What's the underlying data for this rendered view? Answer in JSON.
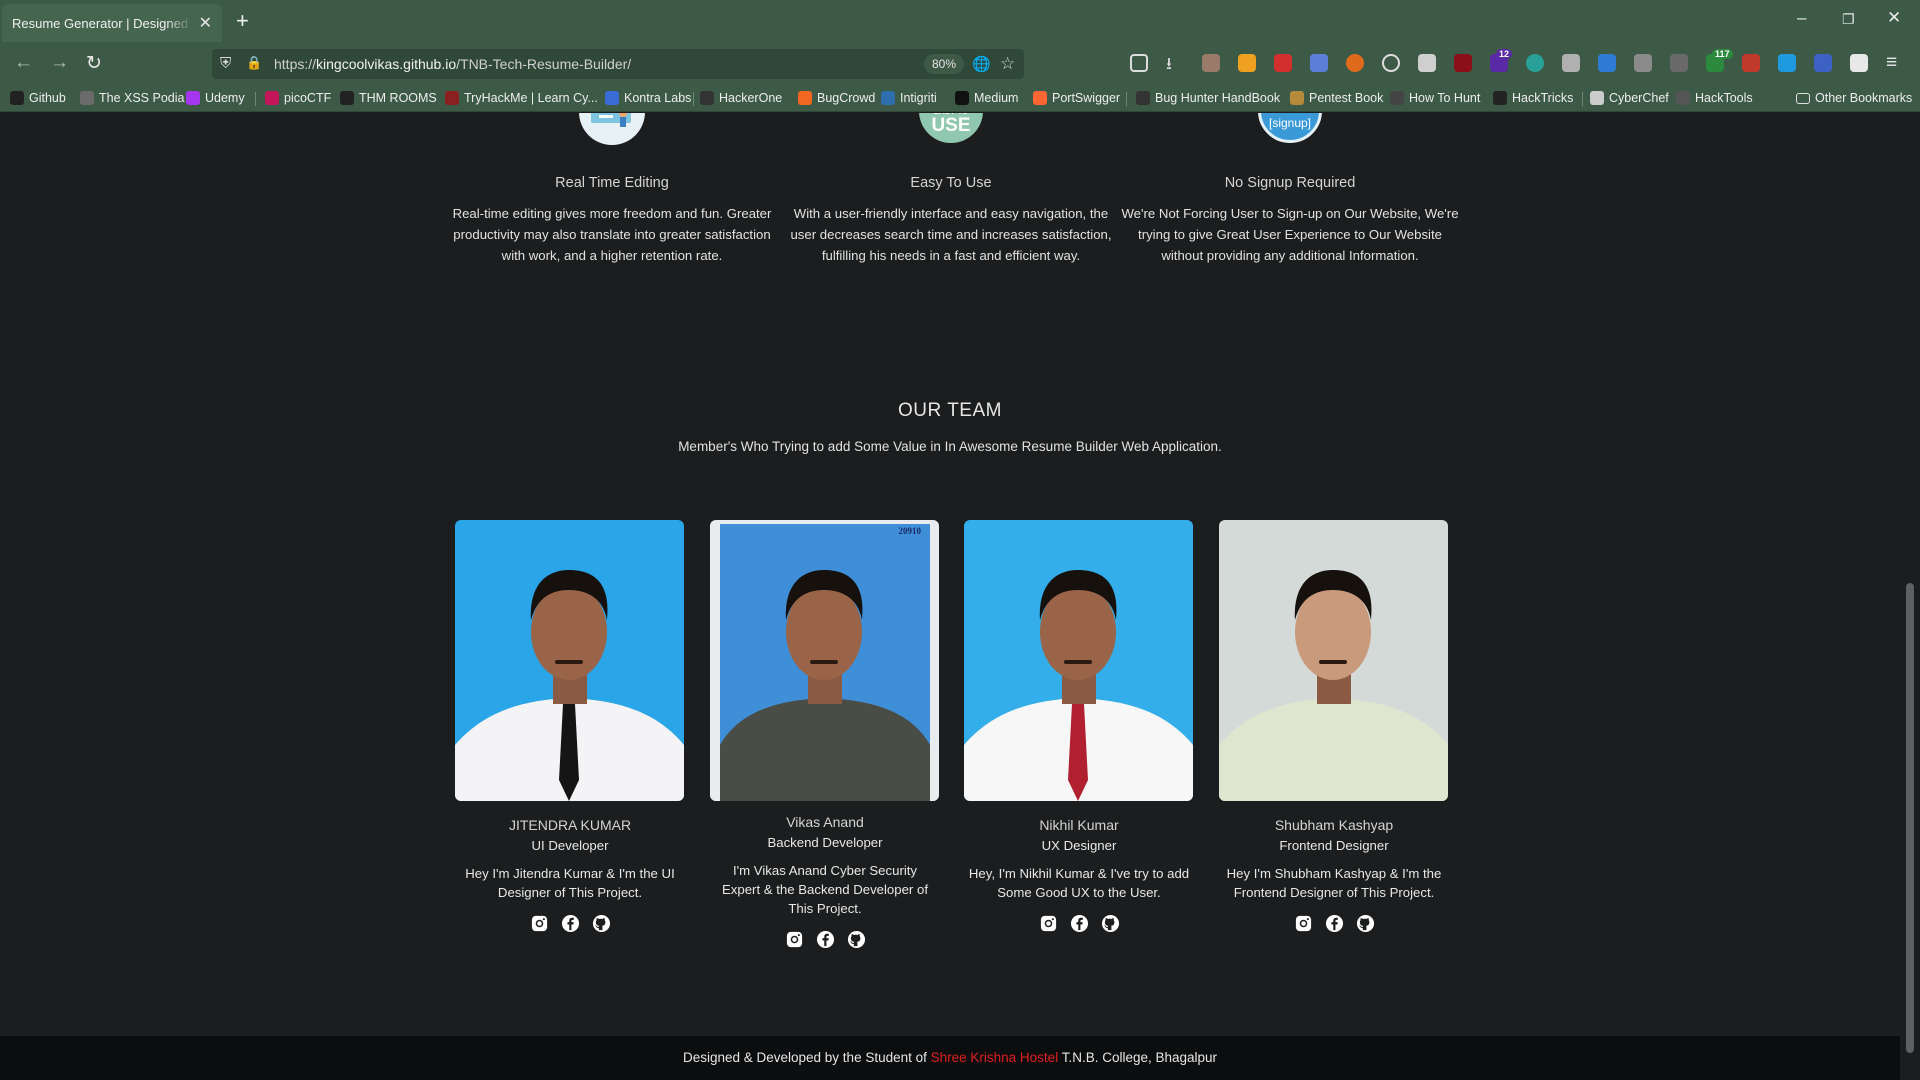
{
  "browser": {
    "tab_title": "Resume Generator | Designed by the Student",
    "url_prefix": "https://",
    "url_domain": "kingcoolvikas.github.io",
    "url_path": "/TNB-Tech-Resume-Builder/",
    "zoom": "80%",
    "ext_badges": {
      "ublock_count": "12",
      "tabs_count": "117"
    },
    "bookmarks": [
      {
        "label": "Github",
        "icon": "github-icon",
        "color": "#222222"
      },
      {
        "label": "The XSS Podia",
        "icon": "document-icon",
        "color": "#6b6b6b"
      },
      {
        "label": "Udemy",
        "icon": "udemy-icon",
        "color": "#a435f0"
      },
      {
        "label": "picoCTF",
        "icon": "pico-icon",
        "color": "#c2185b"
      },
      {
        "label": "THM ROOMS",
        "icon": "github-icon",
        "color": "#222222"
      },
      {
        "label": "TryHackMe | Learn Cy...",
        "icon": "thm-icon",
        "color": "#8a2020"
      },
      {
        "label": "Kontra Labs",
        "icon": "kontra-icon",
        "color": "#3a6bd6"
      },
      {
        "label": "HackerOne",
        "icon": "h1-icon",
        "color": "#333333"
      },
      {
        "label": "BugCrowd",
        "icon": "bugcrowd-icon",
        "color": "#f26822"
      },
      {
        "label": "Intigriti",
        "icon": "intigriti-icon",
        "color": "#2f6fb0"
      },
      {
        "label": "Medium",
        "icon": "medium-icon",
        "color": "#111111"
      },
      {
        "label": "PortSwigger",
        "icon": "portswigger-icon",
        "color": "#ff6633"
      },
      {
        "label": "Bug Hunter HandBook",
        "icon": "handbook-icon",
        "color": "#333333"
      },
      {
        "label": "Pentest Book",
        "icon": "book-icon",
        "color": "#b58a3a"
      },
      {
        "label": "How To Hunt",
        "icon": "hunter-icon",
        "color": "#444444"
      },
      {
        "label": "HackTricks",
        "icon": "hacktricks-icon",
        "color": "#222222"
      },
      {
        "label": "CyberChef",
        "icon": "chef-icon",
        "color": "#cccccc"
      },
      {
        "label": "HackTools",
        "icon": "globe-icon",
        "color": "#555555"
      },
      {
        "label": "Other Bookmarks",
        "icon": "folder-icon",
        "color": "#3c5a46"
      }
    ]
  },
  "features": [
    {
      "icon_label": "",
      "title": "Real Time Editing",
      "desc": "Real-time editing gives more freedom and fun. Greater productivity may also translate into greater satisfaction with work, and a higher retention rate."
    },
    {
      "icon_label": "EASY TO USE",
      "title": "Easy To Use",
      "desc": "With a user-friendly interface and easy navigation, the user decreases search time and increases satisfaction, fulfilling his needs in a fast and efficient way."
    },
    {
      "icon_label": "[signup]",
      "title": "No Signup Required",
      "desc": "We're Not Forcing User to Sign-up on Our Website, We're trying to give Great User Experience to Our Website without providing any additional Information."
    }
  ],
  "team": {
    "title": "OUR TEAM",
    "subtitle": "Member's Who Trying to add Some Value in In Awesome Resume Builder Web Application.",
    "members": [
      {
        "name": "JITENDRA KUMAR",
        "role": "UI Developer",
        "bio": "Hey I'm Jitendra Kumar & I'm the UI Designer of This Project.",
        "photo_bg": "#2aa5e8",
        "shirt": "#f4f4f6",
        "tie": "#151515"
      },
      {
        "name": "Vikas Anand",
        "role": "Backend Developer",
        "bio": "I'm Vikas Anand Cyber Security Expert & the Backend Developer of This Project.",
        "photo_bg": "#3f8fd8",
        "shirt": "#4a4d45",
        "tie": "",
        "stamp": "20910"
      },
      {
        "name": "Nikhil Kumar",
        "role": "UX Designer",
        "bio": "Hey, I'm Nikhil Kumar & I've try to add Some Good UX to the User.",
        "photo_bg": "#33aeea",
        "shirt": "#f7f7f7",
        "tie": "#b02030"
      },
      {
        "name": "Shubham Kashyap",
        "role": "Frontend Designer",
        "bio": "Hey I'm Shubham Kashyap & I'm the Frontend Designer of This Project.",
        "photo_bg": "#d4dad8",
        "shirt": "#dfe6cf",
        "tie": ""
      }
    ]
  },
  "footer": {
    "prefix": "Designed & Developed by the Student of ",
    "highlight": "Shree Krishna Hostel",
    "suffix": " T.N.B. College, Bhagalpur"
  }
}
